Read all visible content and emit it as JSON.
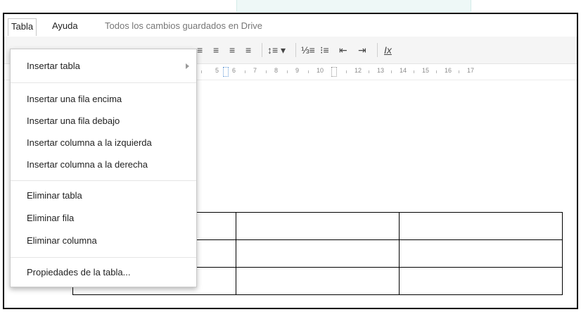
{
  "menubar": {
    "items": [
      {
        "label": "Tabla"
      },
      {
        "label": "Ayuda"
      }
    ],
    "status": "Todos los cambios guardados en Drive"
  },
  "dropdown": {
    "items": [
      {
        "label": "Insertar tabla"
      },
      {
        "label": "Insertar una fila encima"
      },
      {
        "label": "Insertar una fila debajo"
      },
      {
        "label": "Insertar columna a la izquierda"
      },
      {
        "label": "Insertar columna a la derecha"
      },
      {
        "label": "Eliminar tabla"
      },
      {
        "label": "Eliminar fila"
      },
      {
        "label": "Eliminar columna"
      },
      {
        "label": "Propiedades de la tabla..."
      }
    ]
  },
  "toolbar": {
    "icons": [
      "align-left-icon",
      "align-center-icon",
      "align-right-icon",
      "align-justify-icon",
      "line-spacing-icon",
      "numbered-list-icon",
      "bulleted-list-icon",
      "decrease-indent-icon",
      "increase-indent-icon",
      "clear-formatting-icon"
    ],
    "glyphs": {
      "align_left": "≡",
      "align_center": "≡",
      "align_right": "≡",
      "align_justify": "≡",
      "line_spacing": "↕≡ ▾",
      "numbered_list": "⅓≡",
      "bulleted_list": "⁝≡",
      "decrease_indent": "⇤",
      "increase_indent": "⇥",
      "clear_formatting": "Ix"
    }
  },
  "ruler": {
    "numbers": [
      "5",
      "6",
      "7",
      "8",
      "9",
      "10",
      "12",
      "13",
      "14",
      "15",
      "16",
      "17"
    ]
  },
  "document": {
    "table": {
      "rows": 3,
      "cols": 3
    }
  },
  "colors": {
    "accent_tab": "#eef8f7",
    "ruler_marker": "#6a9fd8"
  }
}
